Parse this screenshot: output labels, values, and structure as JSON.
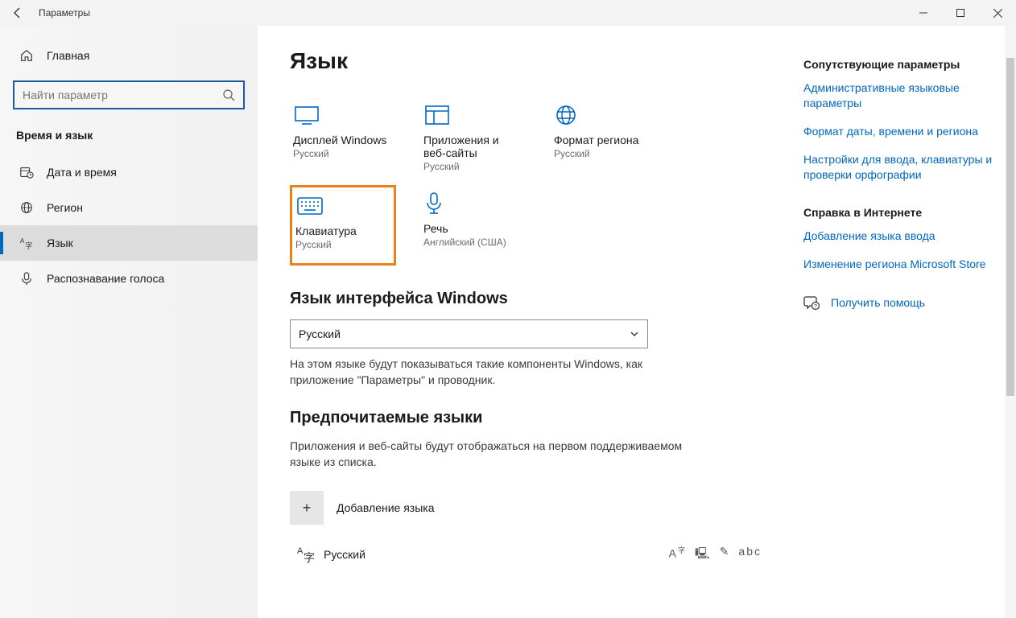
{
  "window": {
    "title": "Параметры"
  },
  "sidebar": {
    "home": "Главная",
    "search_placeholder": "Найти параметр",
    "group": "Время и язык",
    "items": [
      {
        "label": "Дата и время"
      },
      {
        "label": "Регион"
      },
      {
        "label": "Язык"
      },
      {
        "label": "Распознавание голоса"
      }
    ],
    "active_index": 2
  },
  "page": {
    "title": "Язык",
    "tiles": [
      {
        "title": "Дисплей Windows",
        "sub": "Русский",
        "icon": "monitor"
      },
      {
        "title": "Приложения и веб-сайты",
        "sub": "Русский",
        "icon": "windows-panels"
      },
      {
        "title": "Формат региона",
        "sub": "Русский",
        "icon": "globe"
      },
      {
        "title": "Клавиатура",
        "sub": "Русский",
        "icon": "keyboard",
        "highlight": true
      },
      {
        "title": "Речь",
        "sub": "Английский (США)",
        "icon": "microphone"
      }
    ],
    "display_lang_heading": "Язык интерфейса Windows",
    "display_lang_value": "Русский",
    "display_lang_desc": "На этом языке будут показываться такие компоненты Windows, как приложение \"Параметры\" и проводник.",
    "preferred_heading": "Предпочитаемые языки",
    "preferred_desc": "Приложения и веб-сайты будут отображаться на первом поддерживаемом языке из списка.",
    "add_language": "Добавление языка",
    "languages": [
      {
        "name": "Русский"
      }
    ]
  },
  "related": {
    "heading": "Сопутствующие параметры",
    "links": [
      "Административные языковые параметры",
      "Формат даты, времени и региона",
      "Настройки для ввода, клавиатуры и проверки орфографии"
    ],
    "help_heading": "Справка в Интернете",
    "help_links": [
      "Добавление языка ввода",
      "Изменение региона Microsoft Store"
    ],
    "get_help": "Получить помощь"
  }
}
